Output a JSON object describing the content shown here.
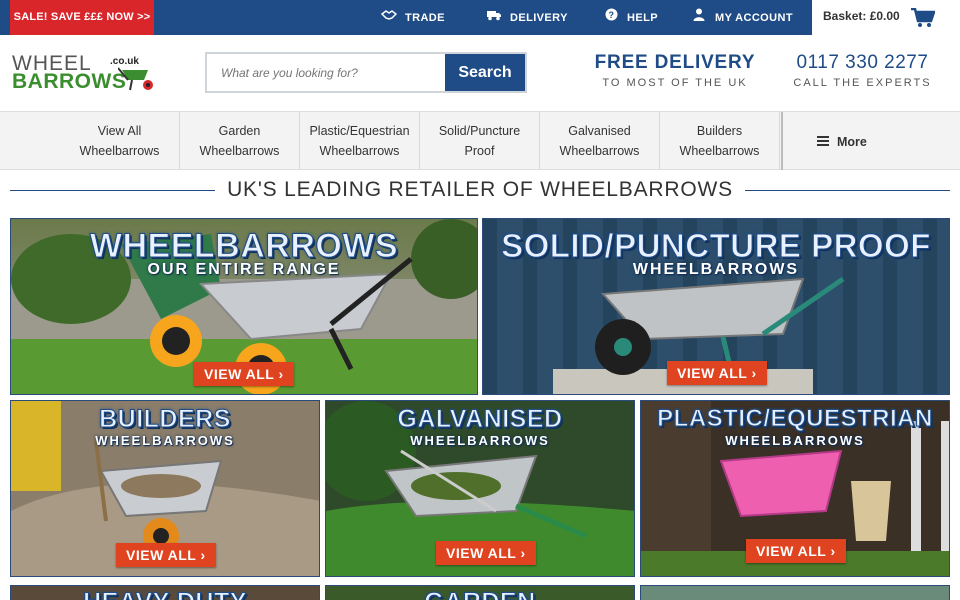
{
  "topbar": {
    "sale_label": "SALE! SAVE £££ NOW >>",
    "links": [
      {
        "label": "TRADE",
        "icon": "handshake-icon"
      },
      {
        "label": "DELIVERY",
        "icon": "truck-icon"
      },
      {
        "label": "HELP",
        "icon": "question-icon"
      },
      {
        "label": "MY ACCOUNT",
        "icon": "user-icon"
      }
    ],
    "basket_label": "Basket: £0.00",
    "colors": {
      "bar": "#1f4c86",
      "sale": "#d8262b"
    }
  },
  "header": {
    "logo": {
      "line1": "WHEEL",
      "line2": "BARROWS",
      "suffix": ".co.uk"
    },
    "search": {
      "placeholder": "What are you looking for?",
      "button_label": "Search"
    },
    "delivery": {
      "title": "FREE DELIVERY",
      "subtitle": "TO MOST OF THE UK"
    },
    "phone": {
      "number": "0117 330 2277",
      "subtitle": "CALL THE EXPERTS"
    }
  },
  "nav": {
    "items": [
      {
        "line1": "View All",
        "line2": "Wheelbarrows"
      },
      {
        "line1": "Garden",
        "line2": "Wheelbarrows"
      },
      {
        "line1": "Plastic/Equestrian",
        "line2": "Wheelbarrows"
      },
      {
        "line1": "Solid/Puncture",
        "line2": "Proof"
      },
      {
        "line1": "Galvanised",
        "line2": "Wheelbarrows"
      },
      {
        "line1": "Builders",
        "line2": "Wheelbarrows"
      }
    ],
    "more_label": "More"
  },
  "main": {
    "heading": "UK'S LEADING RETAILER OF WHEELBARROWS",
    "tiles": [
      {
        "title": "WHEELBARROWS",
        "subtitle": "OUR ENTIRE RANGE",
        "button": "VIEW ALL ›"
      },
      {
        "title": "SOLID/PUNCTURE PROOF",
        "subtitle": "WHEELBARROWS",
        "button": "VIEW ALL ›"
      },
      {
        "title": "BUILDERS",
        "subtitle": "WHEELBARROWS",
        "button": "VIEW ALL ›"
      },
      {
        "title": "GALVANISED",
        "subtitle": "WHEELBARROWS",
        "button": "VIEW ALL ›"
      },
      {
        "title": "PLASTIC/EQUESTRIAN",
        "subtitle": "WHEELBARROWS",
        "button": "VIEW ALL ›"
      },
      {
        "title": "HEAVY DUTY"
      },
      {
        "title": "GARDEN"
      }
    ]
  }
}
